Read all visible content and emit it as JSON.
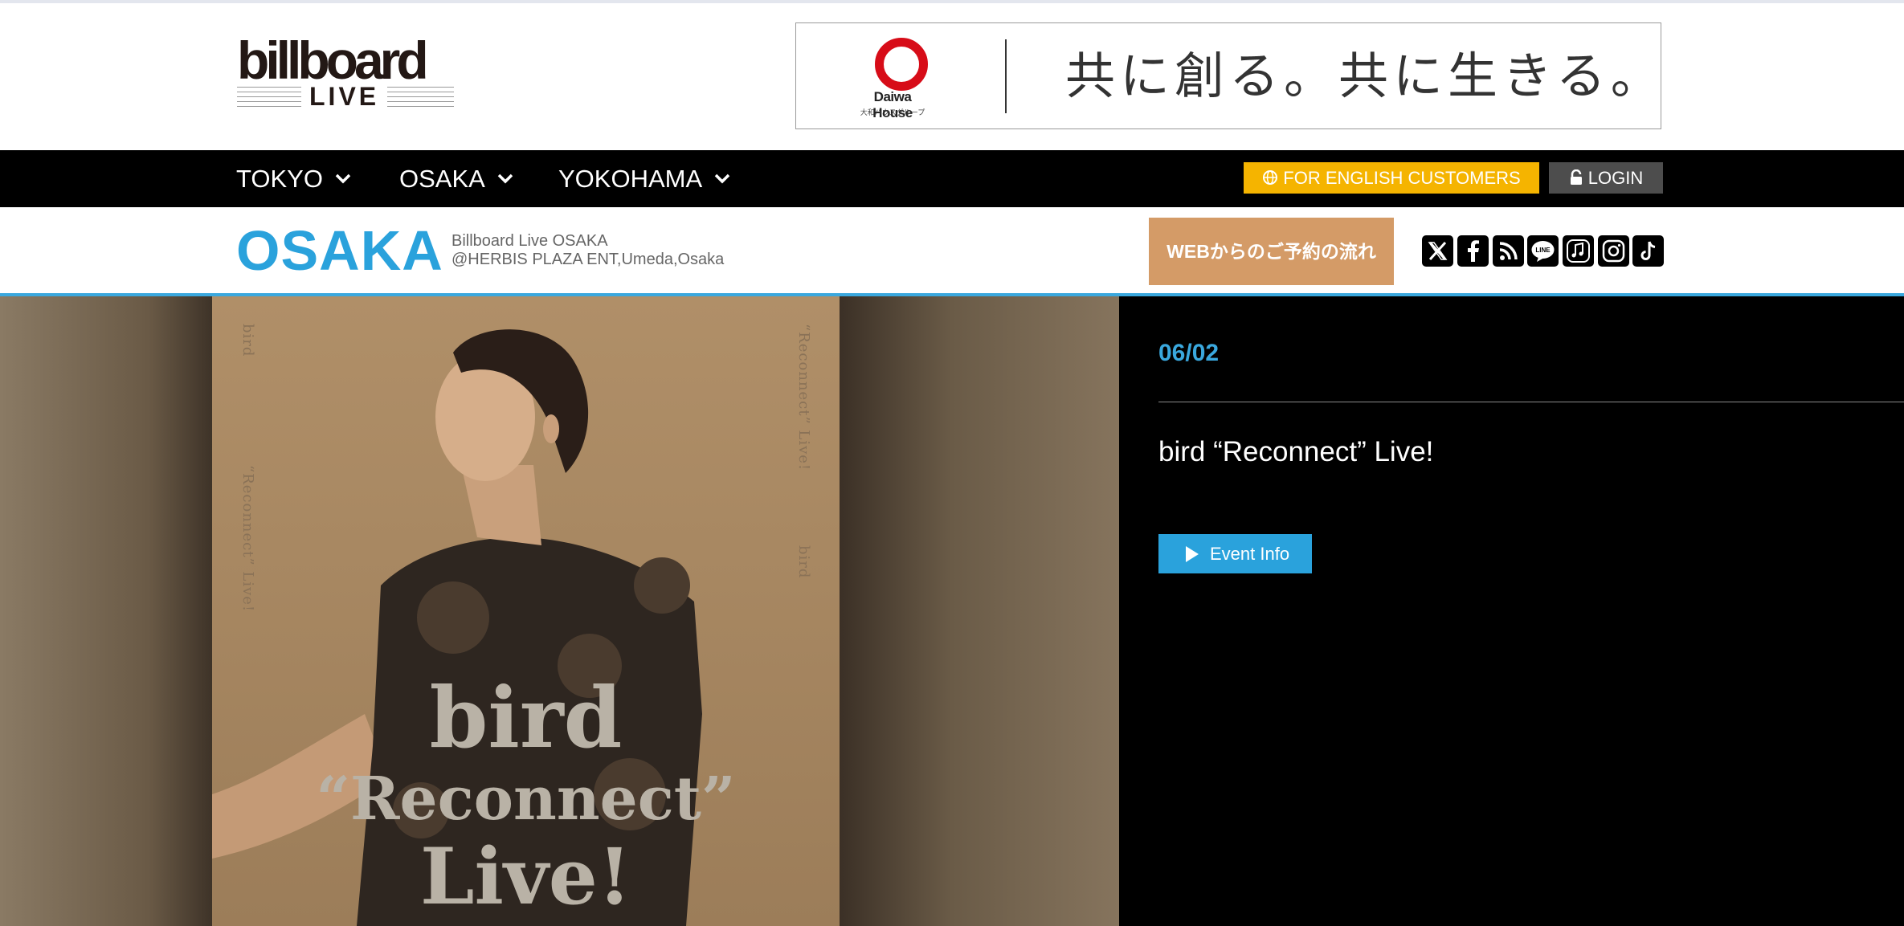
{
  "logo": {
    "word": "billboard",
    "sub": "LIVE"
  },
  "ad": {
    "brand": "Daiwa House",
    "brand_sub": "大和ハウスグループ",
    "slogan": "共に創る。共に生きる。",
    "brand_color": "#d70c18"
  },
  "nav": {
    "items": [
      {
        "label": "TOKYO"
      },
      {
        "label": "OSAKA"
      },
      {
        "label": "YOKOHAMA"
      }
    ],
    "english_label": "FOR ENGLISH CUSTOMERS",
    "login_label": "LOGIN"
  },
  "venue": {
    "title": "OSAKA",
    "line1": "Billboard Live OSAKA",
    "line2": "@HERBIS PLAZA ENT,Umeda,Osaka",
    "flow_label": "WEBからのご予約の流れ",
    "social_icons": [
      "x-icon",
      "facebook-icon",
      "rss-icon",
      "line-icon",
      "apple-music-icon",
      "instagram-icon",
      "tiktok-icon"
    ]
  },
  "poster": {
    "side_left_top": "bird",
    "side_left_bottom": "“Reconnect” Live!",
    "side_right_top": "“Reconnect” Live!",
    "side_right_bottom": "bird",
    "title_line1": "bird",
    "title_line2": "“Reconnect”",
    "title_line3": "Live!"
  },
  "event": {
    "date": "06/02",
    "title": "bird “Reconnect” Live!",
    "button_label": "Event Info"
  },
  "colors": {
    "accent": "#2aa2dc",
    "english_button": "#f5b400",
    "login_button": "#4d4d4d",
    "flow_button": "#d49b67"
  }
}
